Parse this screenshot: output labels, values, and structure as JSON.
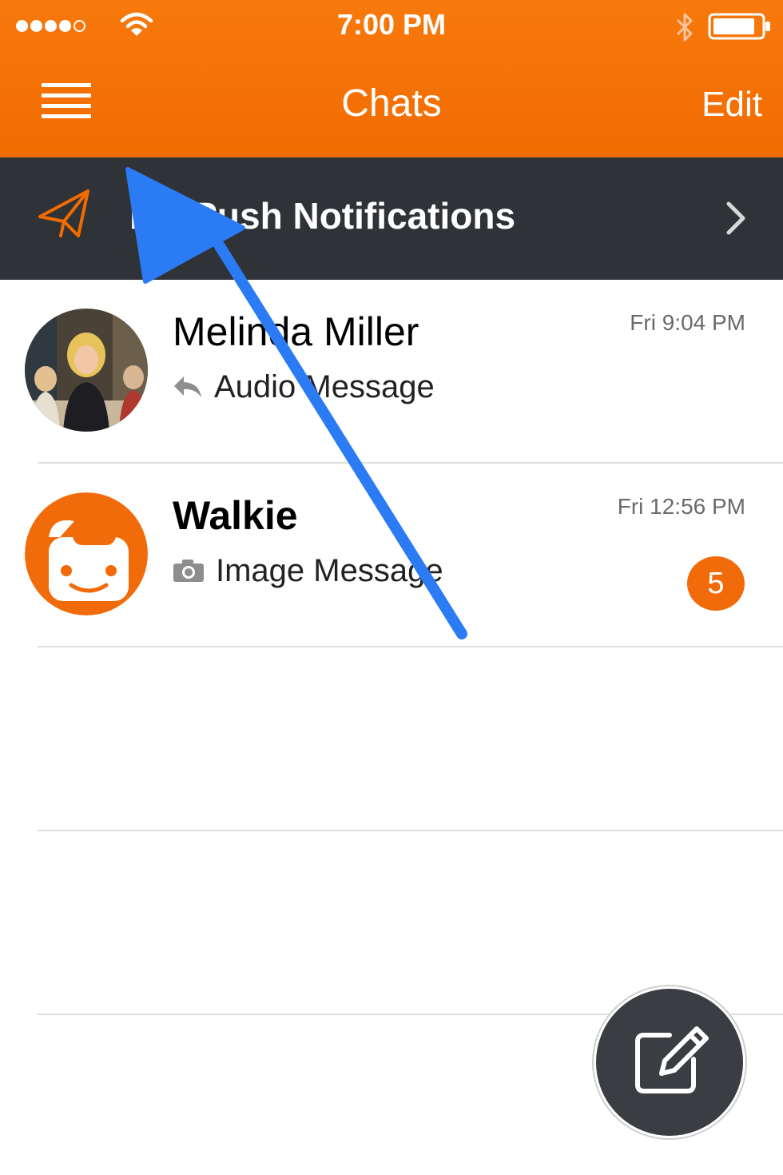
{
  "status_bar": {
    "time": "7:00 PM",
    "icons": [
      "signal-dots-icon",
      "wifi-icon",
      "bluetooth-icon",
      "battery-icon"
    ]
  },
  "nav": {
    "title": "Chats",
    "edit_label": "Edit",
    "menu_icon": "hamburger-menu-icon"
  },
  "banner": {
    "label": "ble Push Notifications",
    "icon": "paper-plane-icon",
    "chevron_icon": "chevron-right-icon"
  },
  "chats": [
    {
      "name": "Melinda Miller",
      "preview": "Audio Message",
      "preview_icon": "reply-arrow-icon",
      "time": "Fri 9:04 PM"
    },
    {
      "name": "Walkie",
      "preview": "Image Message",
      "preview_icon": "camera-icon",
      "time": "Fri 12:56 PM",
      "badge": "5"
    }
  ],
  "fab": {
    "icon": "compose-icon"
  },
  "colors": {
    "accent": "#f26b00",
    "banner_bg": "#2f3237",
    "badge": "#f26b0a",
    "annotation_arrow": "#2a7bf4"
  }
}
